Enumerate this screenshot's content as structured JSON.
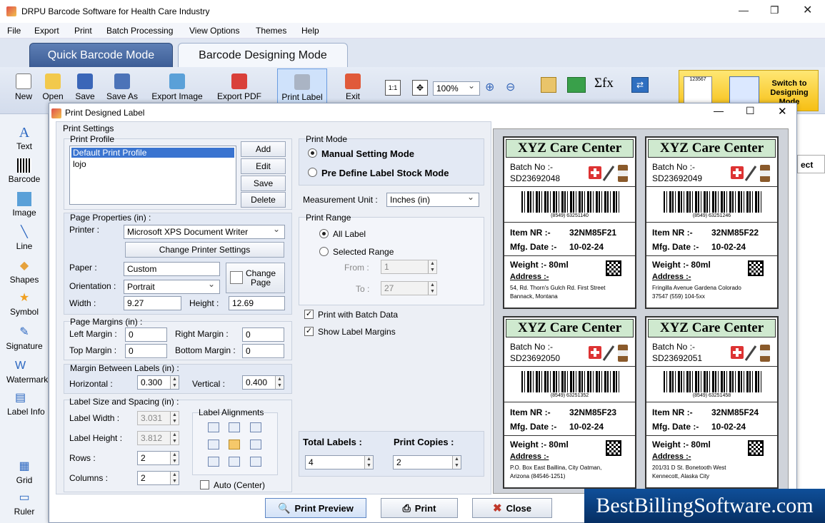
{
  "window": {
    "title": "DRPU Barcode Software for Health Care Industry"
  },
  "menu": [
    "File",
    "Export",
    "Print",
    "Batch Processing",
    "View Options",
    "Themes",
    "Help"
  ],
  "modes": {
    "quick": "Quick Barcode Mode",
    "designing": "Barcode Designing Mode"
  },
  "toolbar": {
    "items": [
      "New",
      "Open",
      "Save",
      "Save As",
      "Export Image",
      "Export PDF",
      "Print Label",
      "Exit"
    ],
    "zoom": "100%",
    "ratio_icon": "1:1",
    "formula_icon": "Σfx",
    "switch": "Switch to Designing Mode",
    "switch_preview": "123567"
  },
  "left_panel": [
    "Text",
    "Barcode",
    "Image",
    "Line",
    "Shapes",
    "Symbol",
    "Signature",
    "Watermark",
    "Label Info",
    "Grid",
    "Ruler"
  ],
  "background_button": "ect",
  "dialog": {
    "title": "Print Designed Label",
    "print_settings": "Print Settings",
    "print_profile": {
      "title": "Print Profile",
      "items": [
        "Default Print Profile",
        "lojo"
      ],
      "buttons": [
        "Add",
        "Edit",
        "Save",
        "Delete"
      ]
    },
    "page_properties": {
      "title": "Page Properties (in) :",
      "printer_label": "Printer :",
      "printer": "Microsoft XPS Document Writer",
      "change_printer": "Change Printer Settings",
      "paper_label": "Paper :",
      "paper": "Custom",
      "orientation_label": "Orientation :",
      "orientation": "Portrait",
      "change_page": "Change Page",
      "width_label": "Width :",
      "width": "9.27",
      "height_label": "Height :",
      "height": "12.69"
    },
    "page_margins": {
      "title": "Page Margins (in) :",
      "left_label": "Left Margin :",
      "left": "0",
      "right_label": "Right Margin :",
      "right": "0",
      "top_label": "Top Margin :",
      "top": "0",
      "bottom_label": "Bottom Margin :",
      "bottom": "0"
    },
    "margin_between": {
      "title": "Margin Between Labels (in) :",
      "horizontal_label": "Horizontal :",
      "horizontal": "0.300",
      "vertical_label": "Vertical :",
      "vertical": "0.400"
    },
    "label_size": {
      "title": "Label Size and Spacing (in) :",
      "width_label": "Label Width :",
      "width": "3.031",
      "height_label": "Label Height :",
      "height": "3.812",
      "rows_label": "Rows :",
      "rows": "2",
      "columns_label": "Columns :",
      "columns": "2",
      "alignments_title": "Label Alignments",
      "auto_center": "Auto (Center)"
    },
    "print_mode": {
      "title": "Print Mode",
      "manual": "Manual Setting Mode",
      "predefine": "Pre Define Label Stock Mode"
    },
    "measurement": {
      "label": "Measurement Unit :",
      "value": "Inches (in)"
    },
    "print_range": {
      "title": "Print Range",
      "all": "All Label",
      "selected": "Selected Range",
      "from_label": "From :",
      "from": "1",
      "to_label": "To :",
      "to": "27"
    },
    "batch_data": "Print with Batch Data",
    "show_margins": "Show Label Margins",
    "totals": {
      "total_label": "Total Labels :",
      "total": "4",
      "copies_label": "Print Copies :",
      "copies": "2"
    },
    "footer": {
      "preview": "Print Preview",
      "print": "Print",
      "close": "Close"
    }
  },
  "labels": [
    {
      "header": "XYZ Care Center",
      "batch_label": "Batch No :-",
      "batch": "SD23692048",
      "code": "(8549) 63251140",
      "item_label": "Item NR :-",
      "item": "32NM85F21",
      "mfg_label": "Mfg. Date :-",
      "mfg": "10-02-24",
      "weight": "Weight :-  80ml",
      "address_label": "Address :-",
      "addr1": "54, Rd. Thorn's Gulch Rd. First Street",
      "addr2": "Bannack, Montana"
    },
    {
      "header": "XYZ Care Center",
      "batch_label": "Batch No :-",
      "batch": "SD23692049",
      "code": "(8549) 63251246",
      "item_label": "Item NR :-",
      "item": "32NM85F22",
      "mfg_label": "Mfg. Date :-",
      "mfg": "10-02-24",
      "weight": "Weight :-  80ml",
      "address_label": "Address :-",
      "addr1": "Fringilla Avenue Gardena Colorado",
      "addr2": "37547 (559) 104-5xx"
    },
    {
      "header": "XYZ Care Center",
      "batch_label": "Batch No :-",
      "batch": "SD23692050",
      "code": "(8549) 63251352",
      "item_label": "Item NR :-",
      "item": "32NM85F23",
      "mfg_label": "Mfg. Date :-",
      "mfg": "10-02-24",
      "weight": "Weight :-  80ml",
      "address_label": "Address :-",
      "addr1": "P.O. Box East Baillina, City Oatman,",
      "addr2": "Arizona (84546-1251)"
    },
    {
      "header": "XYZ Care Center",
      "batch_label": "Batch No :-",
      "batch": "SD23692051",
      "code": "(8549) 63251458",
      "item_label": "Item NR :-",
      "item": "32NM85F24",
      "mfg_label": "Mfg. Date :-",
      "mfg": "10-02-24",
      "weight": "Weight :-  80ml",
      "address_label": "Address :-",
      "addr1": "201/31 D St. Bonetooth West",
      "addr2": "Kennecott, Alaska City"
    }
  ],
  "brand": "BestBillingSoftware.com"
}
